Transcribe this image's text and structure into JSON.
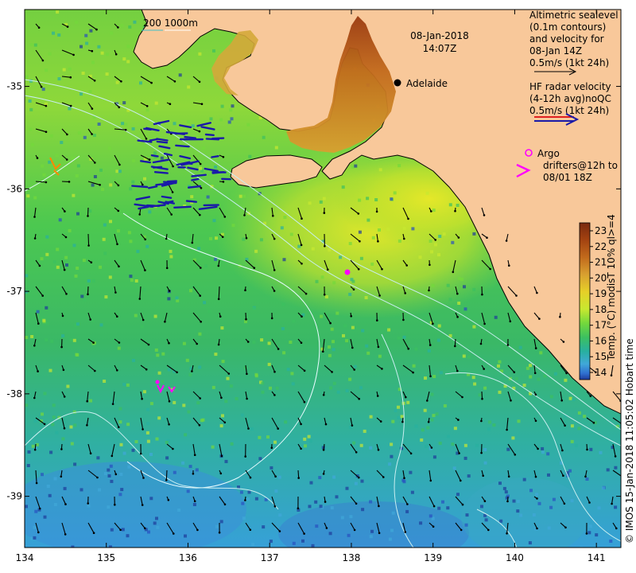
{
  "map": {
    "date_line": "08-Jan-2018",
    "time_line": "14:07Z",
    "place_label": "Adelaide",
    "scale_label": "200  1000m",
    "x_ticks": [
      "134",
      "135",
      "136",
      "137",
      "138",
      "139",
      "140",
      "141"
    ],
    "y_ticks": [
      "-35",
      "-36",
      "-37",
      "-38",
      "-39"
    ],
    "credit": "© IMOS 15-Jan-2018 11:05:02 Hobart time"
  },
  "legend": {
    "altimetry": [
      "Altimetric sealevel",
      "(0.1m contours)",
      "and velocity for",
      "08-Jan 14Z",
      "0.5m/s (1kt 24h)"
    ],
    "hf_radar": [
      "HF radar velocity",
      "(4-12h avg)noQC",
      "0.5m/s (1kt 24h)"
    ],
    "argo": [
      "Argo",
      "drifters@12h to",
      "08/01 18Z"
    ]
  },
  "colorbar": {
    "ticks": [
      "23",
      "22",
      "21",
      "20",
      "19",
      "18",
      "17",
      "16",
      "15",
      "14"
    ],
    "title": "Temp. (°C) modisT 10% ql>=4",
    "colors": [
      "#7a2a10",
      "#a04010",
      "#c26a1c",
      "#d8a030",
      "#e6d028",
      "#c8e830",
      "#74d83c",
      "#3cc060",
      "#28b0a0",
      "#40a8d8",
      "#3070d0",
      "#1e3a9a"
    ]
  },
  "colors": {
    "land": "#f8c89a",
    "coast": "#000000",
    "contour": "#c8eef0",
    "hf_arrow": "#1a1aa8",
    "argo": "#ff00ff"
  }
}
